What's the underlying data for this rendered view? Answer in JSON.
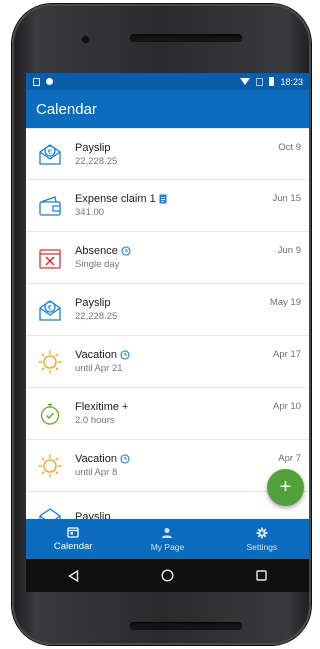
{
  "status_bar": {
    "time": "18:23"
  },
  "app_bar": {
    "title": "Calendar"
  },
  "list": [
    {
      "title": "Payslip",
      "subtitle": "22,228.25",
      "date": "Oct 9",
      "icon": "payslip-icon"
    },
    {
      "title": "Expense claim 1",
      "subtitle": "341.00",
      "date": "Jun 15",
      "icon": "wallet-icon",
      "badge": "document-icon"
    },
    {
      "title": "Absence",
      "subtitle": "Single day",
      "date": "Jun 9",
      "icon": "absence-icon",
      "badge": "clock-icon"
    },
    {
      "title": "Payslip",
      "subtitle": "22,228.25",
      "date": "May 19",
      "icon": "payslip-icon"
    },
    {
      "title": "Vacation",
      "subtitle": "until Apr 21",
      "date": "Apr 17",
      "icon": "sun-icon",
      "badge": "clock-icon"
    },
    {
      "title": "Flexitime +",
      "subtitle": "2.0 hours",
      "date": "Apr 10",
      "icon": "stopwatch-icon"
    },
    {
      "title": "Vacation",
      "subtitle": "until Apr 8",
      "date": "Apr 7",
      "icon": "sun-icon",
      "badge": "clock-icon"
    },
    {
      "title": "Payslip",
      "subtitle": "",
      "date": "",
      "icon": "payslip-icon"
    }
  ],
  "fab": {
    "label": "+"
  },
  "bottom_nav": [
    {
      "label": "Calendar",
      "icon": "calendar-icon",
      "active": true
    },
    {
      "label": "My Page",
      "icon": "person-icon",
      "active": false
    },
    {
      "label": "Settings",
      "icon": "gear-icon",
      "active": false
    }
  ],
  "colors": {
    "app_bar": "#0b6cbd",
    "status_bar": "#0a5da8",
    "fab": "#52a03a",
    "icon_blue": "#1a7fd4",
    "icon_red": "#d9342b",
    "icon_orange": "#f0a020",
    "icon_green": "#6aaa2b"
  }
}
